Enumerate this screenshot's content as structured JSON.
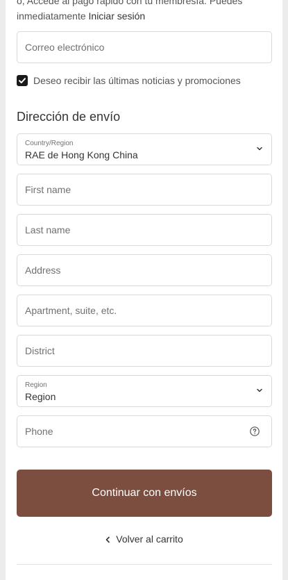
{
  "membership": {
    "clipped_line": "o, Accede al pago rápido con tu membresía. Puedes",
    "line2": "inmediatamente",
    "login_link": "Iniciar sesión"
  },
  "contact": {
    "email_placeholder": "Correo electrónico",
    "newsletter_label": "Deseo recibir las últimas noticias y promociones",
    "newsletter_checked": true
  },
  "shipping": {
    "title": "Dirección de envío",
    "country": {
      "label": "Country/Region",
      "value": "RAE de Hong Kong China"
    },
    "first_name_placeholder": "First name",
    "last_name_placeholder": "Last name",
    "address_placeholder": "Address",
    "apartment_placeholder": "Apartment, suite, etc.",
    "district_placeholder": "District",
    "region": {
      "label": "Region",
      "value": "Region"
    },
    "phone_placeholder": "Phone"
  },
  "actions": {
    "continue_label": "Continuar con envíos",
    "back_label": "Volver al carrito"
  },
  "colors": {
    "button": "#7b4e40",
    "checkbox": "#1a1a1a"
  }
}
